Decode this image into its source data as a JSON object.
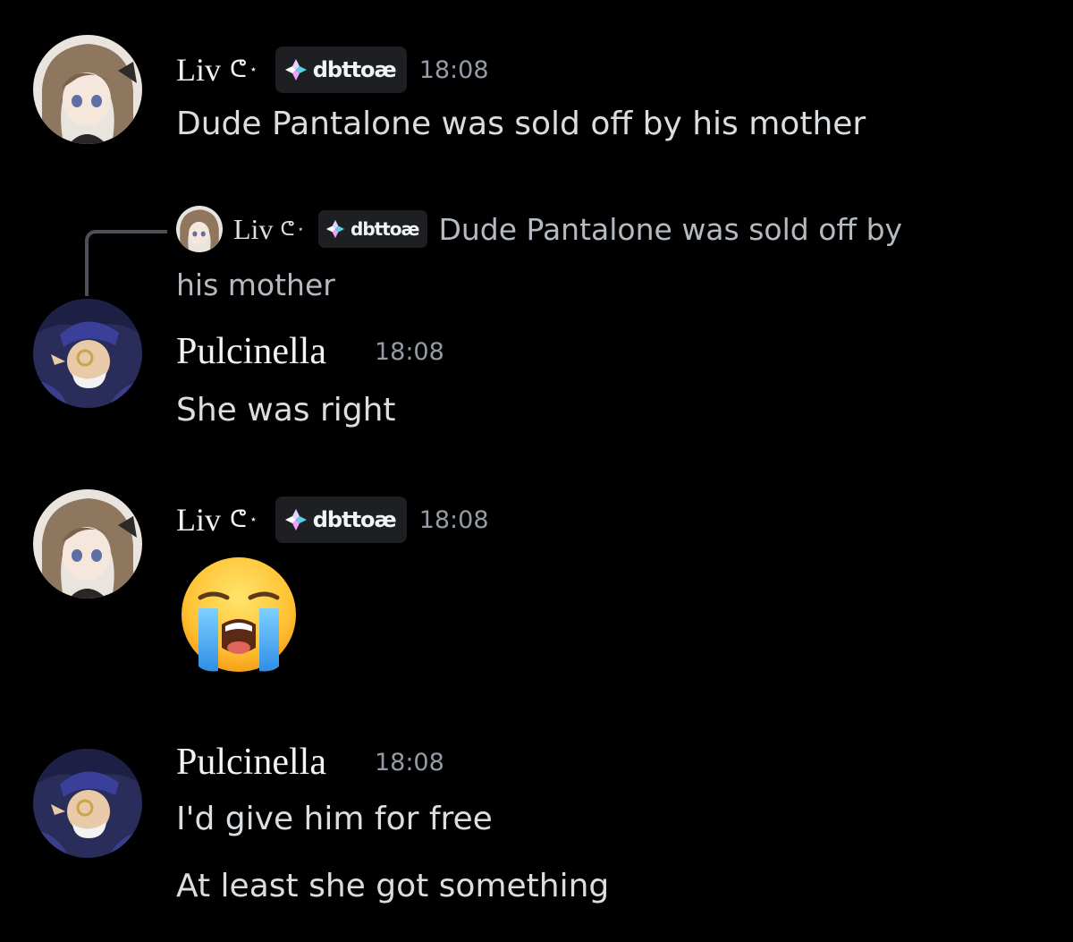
{
  "colors": {
    "background": "#000000",
    "name": "#f2f3f5",
    "text": "#dbdee1",
    "timestamp": "#949ba4",
    "reply_text": "#b5bac1",
    "tag_background": "#1e1f22"
  },
  "messages": [
    {
      "author": "Liv",
      "deco": "ᕦ",
      "deco_star": "⋆",
      "tag": "dbttoæ",
      "tag_icon": "sparkle-diamond-icon",
      "time": "18:08",
      "text": "Dude Pantalone was sold off by his mother"
    },
    {
      "author": "Pulcinella",
      "time": "18:08",
      "reply": {
        "author": "Liv",
        "deco": "ᕦ",
        "deco_star": "⋆",
        "tag": "dbttoæ",
        "text_line1": "Dude Pantalone was sold off by",
        "text_line2": "his mother"
      },
      "text": "She was right"
    },
    {
      "author": "Liv",
      "deco": "ᕦ",
      "deco_star": "⋆",
      "tag": "dbttoæ",
      "time": "18:08",
      "emoji": "loudly-crying-face"
    },
    {
      "author": "Pulcinella",
      "time": "18:08",
      "text": "I'd give him for free",
      "text2": "At least she got something"
    }
  ]
}
